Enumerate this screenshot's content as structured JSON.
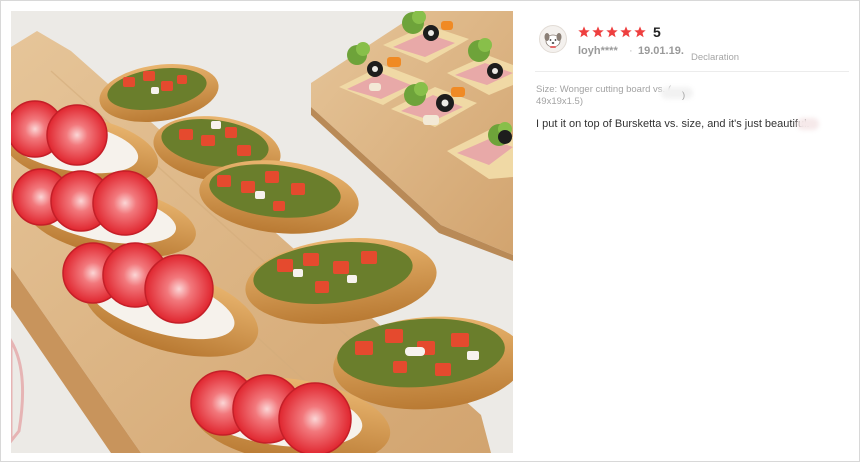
{
  "review": {
    "rating_stars": 5,
    "rating_value": "5",
    "user": "loyh****",
    "separator": "·",
    "date": "19.01.19.",
    "declaration": "Declaration",
    "option_line1": "Size: Wonger cutting board vs. (",
    "option_line2": "49x19x1.5)",
    "option_tail": ")",
    "text": "I put it on top of Bursketta vs. size, and it's just beautiful."
  },
  "photo": {
    "subject": "Strawberry and tomato bruschetta on wooden cutting boards"
  },
  "colors": {
    "star": "#ee3f3f",
    "board": "#dcb586",
    "strawberry": "#e8303a",
    "tomato": "#e85030",
    "pesto": "#5f7a2a"
  },
  "icons": {
    "avatar": "puppy-avatar-icon",
    "star": "star-icon"
  }
}
